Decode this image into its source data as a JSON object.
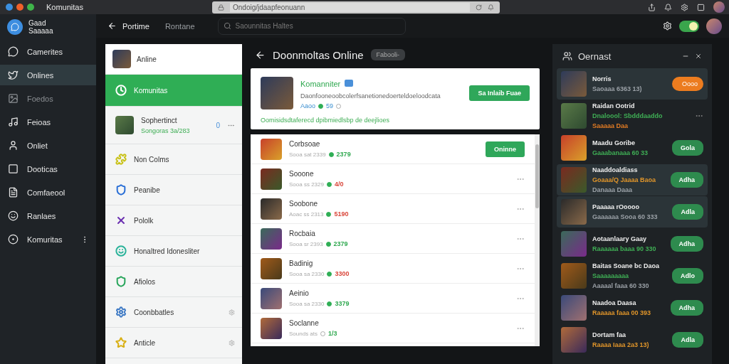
{
  "titlebar": {
    "title": "Komunitas",
    "url": "Ondoig/jdaapfeonuann"
  },
  "brand": {
    "name": "Gaad",
    "subtitle": "Saaaaa"
  },
  "header": {
    "tabs": [
      {
        "label": "Portime",
        "selected": true
      },
      {
        "label": "Rontane",
        "selected": false
      }
    ],
    "search": {
      "placeholder": "Saounnitas Haltes"
    },
    "toggle": {
      "on": true
    }
  },
  "sidebar": {
    "items": [
      {
        "label": "Camerites",
        "selected": false,
        "disabled": false,
        "more": false
      },
      {
        "label": "Onlines",
        "selected": true,
        "disabled": false,
        "more": false
      },
      {
        "label": "Foedos",
        "selected": false,
        "disabled": true,
        "more": false
      },
      {
        "label": "Feioas",
        "selected": false,
        "disabled": false,
        "more": false
      },
      {
        "label": "Onliet",
        "selected": false,
        "disabled": false,
        "more": false
      },
      {
        "label": "Dooticas",
        "selected": false,
        "disabled": false,
        "more": false
      },
      {
        "label": "Comfaeool",
        "selected": false,
        "disabled": false,
        "more": false
      },
      {
        "label": "Ranlaes",
        "selected": false,
        "disabled": false,
        "more": false
      },
      {
        "label": "Komuritas",
        "selected": false,
        "disabled": false,
        "more": true
      }
    ]
  },
  "panel": {
    "header": "Anline",
    "items": [
      {
        "kind": "plain",
        "label": "Komunitas",
        "selected": true,
        "color": "#ffffff"
      },
      {
        "kind": "profile",
        "label": "Sophertinct",
        "sub": "Songoras 3a/283",
        "badge": "0",
        "selected": false
      },
      {
        "kind": "plain",
        "label": "Non Colms",
        "selected": false,
        "color": "#c9c21a"
      },
      {
        "kind": "plain",
        "label": "Peanibe",
        "selected": false,
        "color": "#2a6fd6"
      },
      {
        "kind": "plain",
        "label": "Pololk",
        "selected": false,
        "color": "#6a2fb0"
      },
      {
        "kind": "plain",
        "label": "Honaltred Idonesliter",
        "selected": false,
        "color": "#2bb39a"
      },
      {
        "kind": "plain",
        "label": "Afiolos",
        "selected": false,
        "color": "#27a55a"
      },
      {
        "kind": "action",
        "label": "Coonbbatles",
        "selected": false,
        "color": "#3d79c4"
      },
      {
        "kind": "action",
        "label": "Anticle",
        "selected": false,
        "color": "#d9b016"
      }
    ]
  },
  "center": {
    "title": "Doonmoltas Online",
    "badge": "Fabooli-",
    "card": {
      "name": "Komanniter",
      "description": "Daonfooneoobcolerfsanetionedoerteldoeloodcata",
      "meta": "Aaoo",
      "count": "59",
      "button": "Sa Inlaib Fuae",
      "footer": "Oomisidsdtaferecd dpibmiedlsbp de deejlioes"
    },
    "rows": [
      {
        "name": "Corbsoae",
        "meta": "Sooa sat 2339",
        "value": "2379",
        "color": "#2fa84f",
        "online": true,
        "kind": "button",
        "button": "Oninne"
      },
      {
        "name": "Sooone",
        "meta": "Sooa ss 2329",
        "value": "4/0",
        "color": "#d9463a",
        "online": true,
        "kind": "menu"
      },
      {
        "name": "Soobone",
        "meta": "Aoac ss 2313",
        "value": "5190",
        "color": "#d9463a",
        "online": true,
        "kind": "menu"
      },
      {
        "name": "Rocbaia",
        "meta": "Sooa sr 2393",
        "value": "2379",
        "color": "#2fa84f",
        "online": true,
        "kind": "menu"
      },
      {
        "name": "Badinig",
        "meta": "Sooa sa 2330",
        "value": "3300",
        "color": "#d9463a",
        "online": true,
        "kind": "menu"
      },
      {
        "name": "Aeinio",
        "meta": "Sooa sa 2330",
        "value": "3379",
        "color": "#2fa84f",
        "online": true,
        "kind": "menu"
      },
      {
        "name": "Soclanne",
        "meta": "Sounds ats",
        "value": "1/3",
        "color": "#2fa84f",
        "online": false,
        "kind": "menu"
      }
    ]
  },
  "right": {
    "title": "Oernast",
    "items": [
      {
        "name": "Norris",
        "lines": [
          {
            "text": "Saoaaa 6363 13)",
            "color": "#9aa0a6"
          }
        ],
        "kind": "accent",
        "button": "Oooo",
        "selected": true
      },
      {
        "name": "Raidan Ootrid",
        "lines": [
          {
            "text": "Dnaloool: Sbdddaaddo",
            "color": "#3fae55"
          },
          {
            "text": "Saaaaa Daa",
            "color": "#e07b24"
          }
        ],
        "kind": "menu",
        "selected": false
      },
      {
        "name": "Maadu Goribe",
        "lines": [
          {
            "text": "Gaaabanaaa 60 33",
            "color": "#3fae55"
          }
        ],
        "kind": "button",
        "button": "Gola",
        "selected": false
      },
      {
        "name": "Naaddoaldiass",
        "lines": [
          {
            "text": "Goaaa/Q Jaaaa Baoa",
            "color": "#e0952a"
          },
          {
            "text": "Danaaa Daaa",
            "color": "#9aa0a6"
          }
        ],
        "kind": "button",
        "button": "Adha",
        "selected": true
      },
      {
        "name": "Paaaaa rOoooo",
        "lines": [
          {
            "text": "Gaaaaaa Sooa 60 333",
            "color": "#9aa0a6"
          }
        ],
        "kind": "button",
        "button": "Adla",
        "selected": true
      },
      {
        "name": "Aotaanlaary Gaay",
        "lines": [
          {
            "text": "Raaaaaa baaa 90 330",
            "color": "#3fae55"
          }
        ],
        "kind": "button",
        "button": "Adha",
        "selected": false
      },
      {
        "name": "Baitas Soane bc Daoa",
        "lines": [
          {
            "text": "Saaaaaaaaa",
            "color": "#3fae55"
          },
          {
            "text": "Aaaaal faaa 60 330",
            "color": "#9aa0a6"
          }
        ],
        "kind": "button",
        "button": "Adlo",
        "selected": false
      },
      {
        "name": "Naadoa Daasa",
        "lines": [
          {
            "text": "Raaaaa faaa 00 393",
            "color": "#e0952a"
          }
        ],
        "kind": "button",
        "button": "Adha",
        "selected": false
      },
      {
        "name": "Dortam faa",
        "lines": [
          {
            "text": "Raaaa Iaaa 2a3 13)",
            "color": "#e0952a"
          }
        ],
        "kind": "button",
        "button": "Adla",
        "selected": false
      }
    ]
  }
}
